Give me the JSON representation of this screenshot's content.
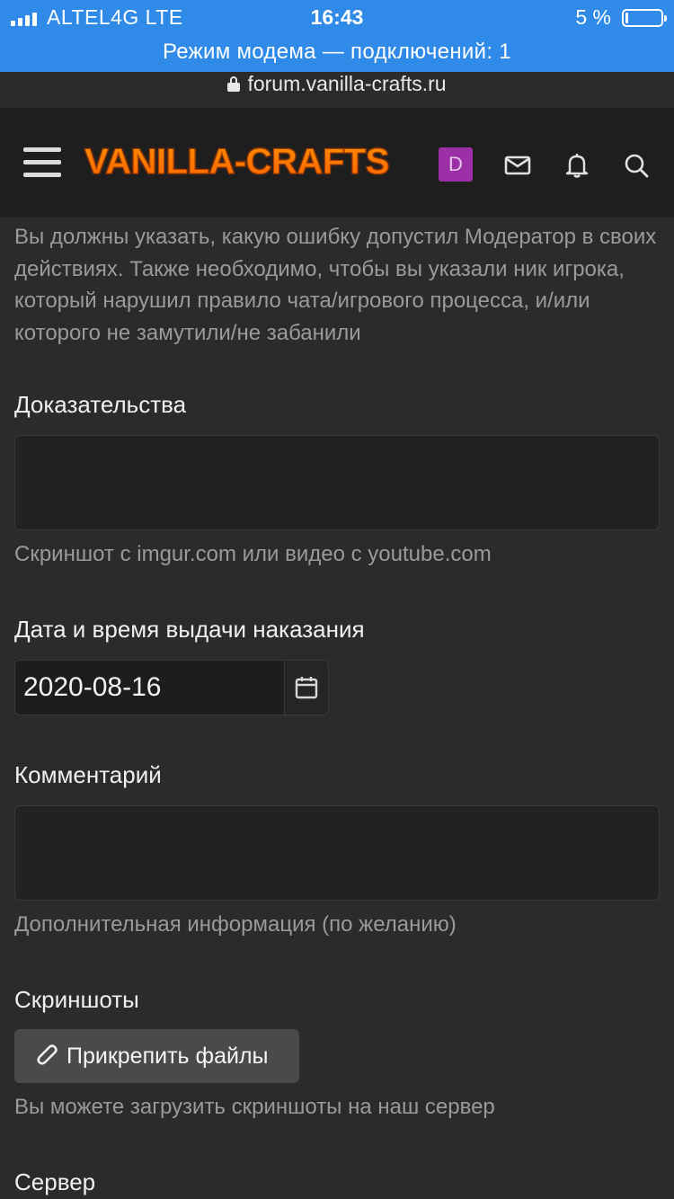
{
  "status_bar": {
    "carrier": "ALTEL4G  LTE",
    "time": "16:43",
    "battery": "5 %",
    "battery_level": 0.05,
    "hotspot": "Режим модема — подключений: 1"
  },
  "browser": {
    "url": "forum.vanilla-crafts.ru"
  },
  "header": {
    "logo": "VANILLA-CRAFTS",
    "avatar_letter": "D",
    "colors": {
      "logo": "#ff8a00",
      "avatar": "#9b2fa6",
      "status_bar": "#2f8ae8"
    },
    "icons": [
      "menu-icon",
      "mail-icon",
      "bell-icon",
      "search-icon"
    ]
  },
  "form": {
    "intro_text": "Вы должны указать, какую ошибку допустил Модератор в своих действиях. Также необходимо, чтобы вы указали ник игрока, который нарушил правило чата/игрового процесса, и/или которого не замутили/не забанили",
    "evidence": {
      "label": "Доказательства",
      "value": "",
      "hint": "Скриншот с imgur.com или видео с youtube.com"
    },
    "date": {
      "label": "Дата и время выдачи наказания",
      "value": "2020-08-16"
    },
    "comment": {
      "label": "Комментарий",
      "value": "",
      "hint": "Дополнительная информация (по желанию)"
    },
    "screenshots": {
      "label": "Скриншоты",
      "button": "Прикрепить файлы",
      "hint": "Вы можете загрузить скриншоты на наш сервер"
    },
    "server": {
      "label": "Сервер"
    }
  }
}
